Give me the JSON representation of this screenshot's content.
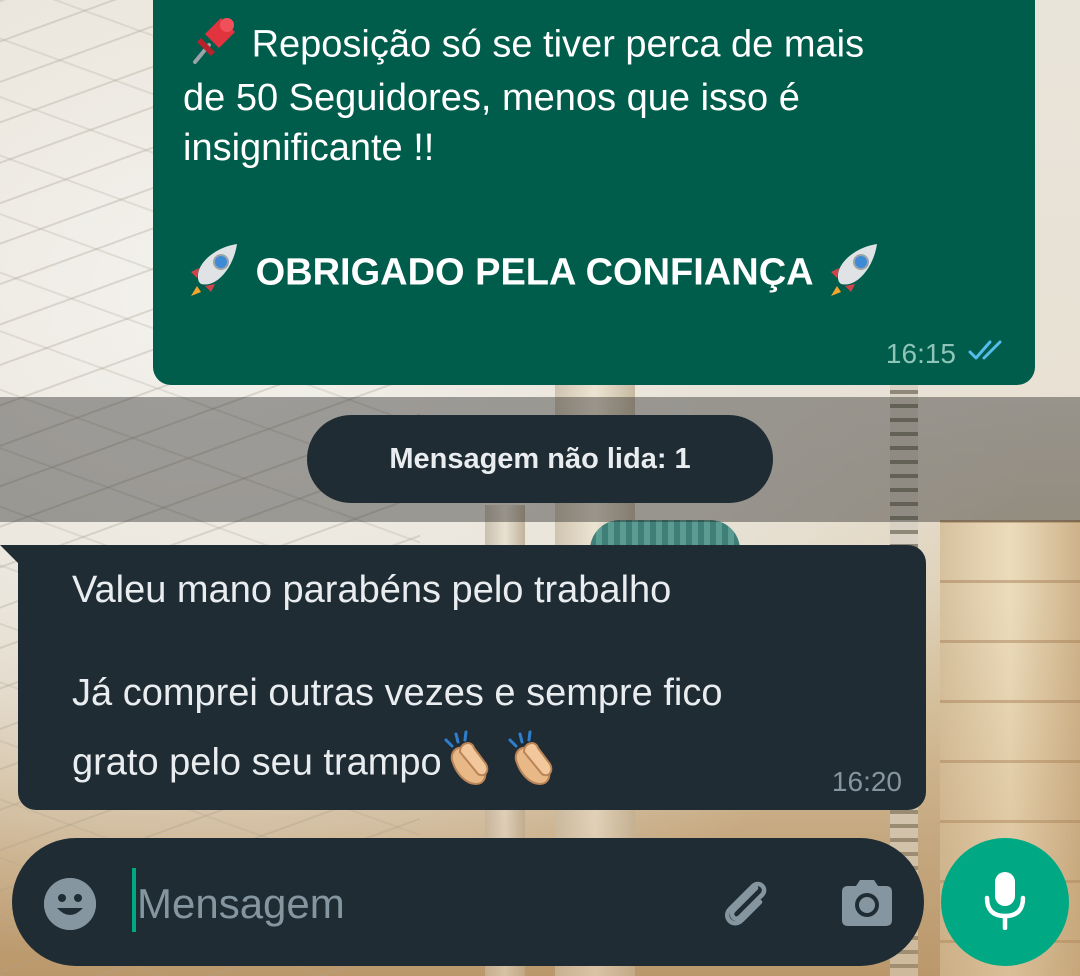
{
  "outgoing": {
    "lines": [
      "Reposição só se tiver perca de mais",
      "de 50 Seguidores, menos que isso é",
      "insignificante !!"
    ],
    "bold_line": "OBRIGADO PELA CONFIANÇA",
    "time": "16:15",
    "status_icon": "double-check-read-icon"
  },
  "unread_banner": "Mensagem não lida: 1",
  "incoming": {
    "line1": "Valeu mano parabéns pelo trabalho",
    "line2": "Já comprei outras vezes e sempre fico",
    "line3": "grato pelo seu trampo",
    "time": "16:20"
  },
  "composer": {
    "placeholder": "Mensagem",
    "icons": [
      "emoji-icon",
      "attach-icon",
      "camera-icon",
      "mic-icon"
    ]
  },
  "colors": {
    "outgoing_bubble": "#005c4b",
    "incoming_bubble": "#1f2c34",
    "accent": "#00a884",
    "read_ticks": "#53bdeb"
  }
}
